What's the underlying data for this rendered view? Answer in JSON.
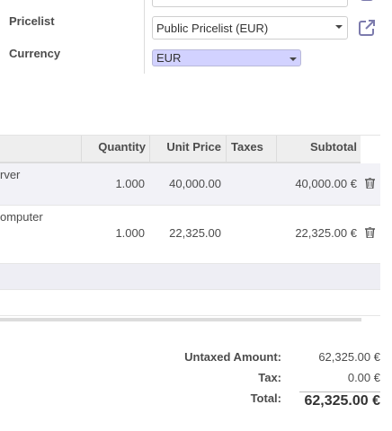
{
  "form": {
    "pricelist_label": "Pricelist",
    "pricelist_value": "Public Pricelist (EUR)",
    "currency_label": "Currency",
    "currency_value": "EUR",
    "currency_highlight": "#d2d2ff",
    "accent_color": "#7c7bad"
  },
  "table": {
    "headers": {
      "quantity": "Quantity",
      "unit_price": "Unit Price",
      "taxes": "Taxes",
      "subtotal": "Subtotal"
    },
    "rows": [
      {
        "description": "rver",
        "quantity": "1.000",
        "unit_price": "40,000.00",
        "taxes": "",
        "subtotal": "40,000.00 €"
      },
      {
        "description": "omputer",
        "quantity": "1.000",
        "unit_price": "22,325.00",
        "taxes": "",
        "subtotal": "22,325.00 €"
      }
    ]
  },
  "totals": {
    "untaxed_label": "Untaxed Amount:",
    "untaxed_value": "62,325.00 €",
    "tax_label": "Tax:",
    "tax_value": "0.00 €",
    "total_label": "Total:",
    "total_value": "62,325.00 €"
  },
  "icons": {
    "external_link": "external-link-icon",
    "delete": "trash-icon",
    "dropdown": "caret-down-icon"
  }
}
